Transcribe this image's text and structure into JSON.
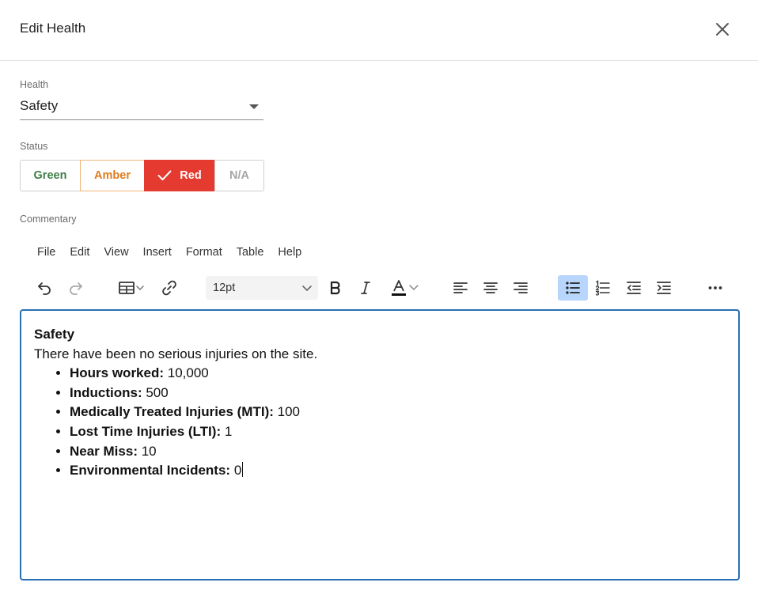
{
  "dialog": {
    "title": "Edit Health",
    "close_icon": "close-icon"
  },
  "health": {
    "label": "Health",
    "value": "Safety"
  },
  "status": {
    "label": "Status",
    "options": [
      {
        "label": "Green",
        "color": "#3f7d4a"
      },
      {
        "label": "Amber",
        "color": "#e07b1e"
      },
      {
        "label": "Red",
        "color": "#e53a2f",
        "selected": true
      },
      {
        "label": "N/A",
        "color": "#a5a5a5"
      }
    ],
    "selected": "Red"
  },
  "commentary": {
    "label": "Commentary",
    "menu": [
      "File",
      "Edit",
      "View",
      "Insert",
      "Format",
      "Table",
      "Help"
    ],
    "toolbar": {
      "icons": [
        "undo-icon",
        "redo-icon",
        "table-icon",
        "link-icon",
        "bold-icon",
        "italic-icon",
        "text-color-icon",
        "align-left-icon",
        "align-center-icon",
        "align-right-icon",
        "bullet-list-icon",
        "numbered-list-icon",
        "outdent-icon",
        "indent-icon",
        "more-icon"
      ],
      "font_size": "12pt",
      "active": "bullet-list-icon",
      "active_color": "#b8d6fb"
    },
    "content": {
      "heading": "Safety",
      "intro": "There have been no serious injuries on the site.",
      "items": [
        {
          "label": "Hours worked:",
          "value": " 10,000"
        },
        {
          "label": "Inductions:",
          "value": " 500"
        },
        {
          "label": "Medically Treated Injuries (MTI):",
          "value": " 100"
        },
        {
          "label": "Lost Time Injuries (LTI):",
          "value": " 1"
        },
        {
          "label": "Near Miss:",
          "value": " 10"
        },
        {
          "label": "Environmental Incidents:",
          "value": " 0"
        }
      ]
    },
    "focus_color": "#2a6fb4"
  }
}
